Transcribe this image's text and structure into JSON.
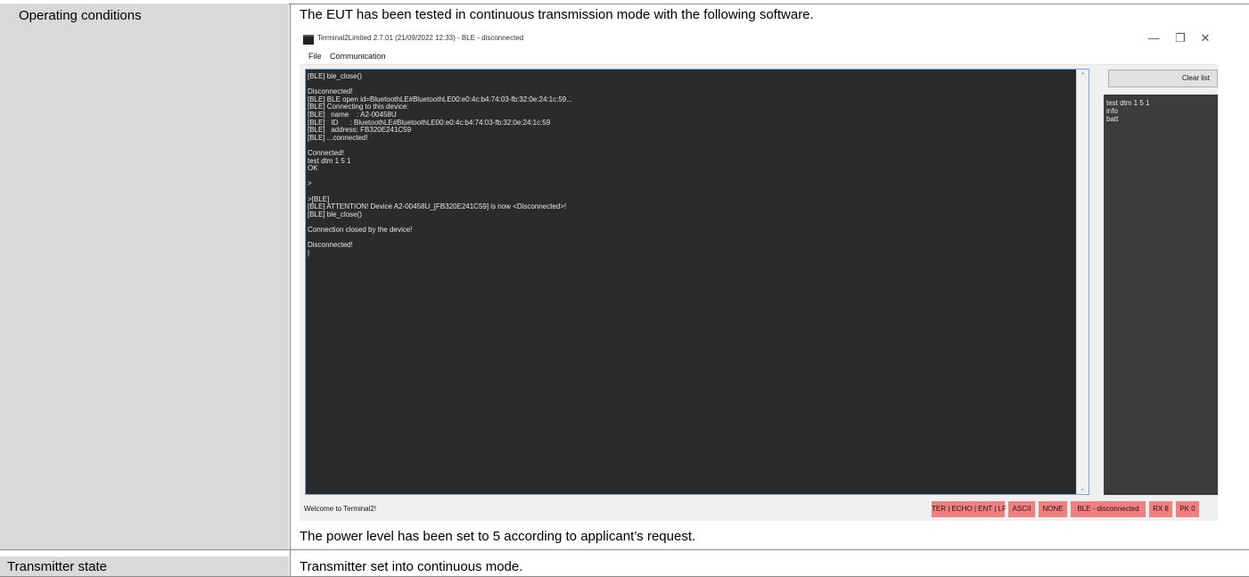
{
  "rows": [
    {
      "label": "Operating conditions",
      "intro": "The EUT has been tested in continuous transmission mode with the following software.",
      "note": "The power level has been set to 5 according to applicant’s request."
    },
    {
      "label": "Transmitter state",
      "text": "Transmitter set into continuous mode."
    }
  ],
  "app": {
    "title": "Terminal2Limited 2.7.01 (21/09/2022 12:33) - BLE - disconnected",
    "window_controls": {
      "minimize": "—",
      "restore": "❐",
      "close": "✕"
    },
    "menu": [
      "File",
      "Communication"
    ],
    "console_lines": [
      "[BLE] ble_close()",
      "",
      "Disconnected!",
      "[BLE] BLE open id=BluetoothLE#BluetoothLE00:e0:4c:b4:74:03-fb:32:0e:24:1c:59...",
      "[BLE] Connecting to this device:",
      "[BLE]   name    : A2-00458U",
      "[BLE]   ID      : BluetoothLE#BluetoothLE00:e0:4c:b4:74:03-fb:32:0e:24:1c:59",
      "[BLE]   address: FB320E241C59",
      "[BLE] ...connected!",
      "",
      "Connected!",
      "test dtm 1 5 1",
      "OK",
      "",
      ">",
      "",
      ">[BLE]",
      "[BLE] ATTENTION! Device A2-00458U_[FB320E241C59] is now <Disconnected>!",
      "[BLE] ble_close()",
      "",
      "Connection closed by the device!",
      "",
      "Disconnected!",
      "|"
    ],
    "clear_button": "Clear list",
    "history": [
      "test dtm 1 5 1",
      "info",
      "batt"
    ],
    "status": {
      "welcome": "Welcome to Terminal2!",
      "badges": [
        "TER | ECHO | ENT | LF",
        "ASCII",
        "NONE",
        "BLE - disconnected",
        "RX 8",
        "PK 0"
      ],
      "badge_color": "#f08080"
    }
  }
}
